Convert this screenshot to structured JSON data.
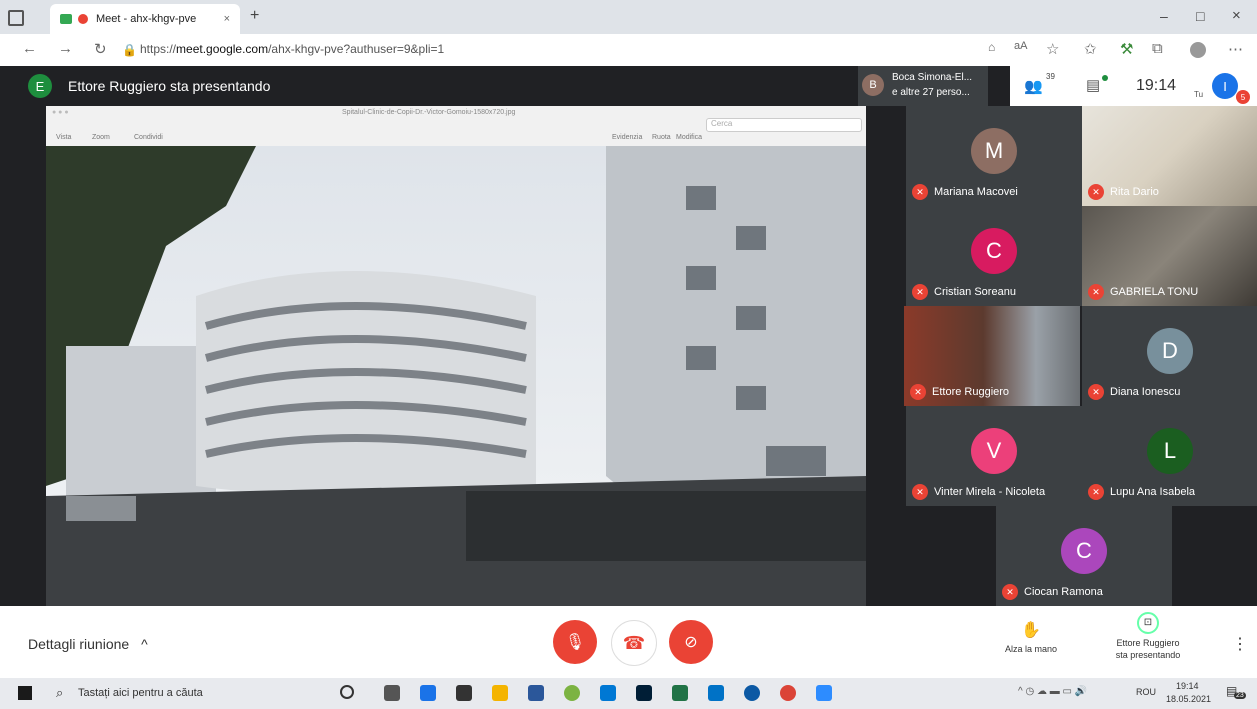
{
  "browser": {
    "tab_title": "Meet - ahx-khgv-pve",
    "new_tab_symbol": "+",
    "url_prefix": "https://",
    "url_domain": "meet.google.com",
    "url_path": "/ahx-khgv-pve?authuser=9&pli=1",
    "window_controls": [
      "–",
      "□",
      "×"
    ]
  },
  "meet": {
    "presenter_initial": "E",
    "presenter_banner": "Ettore Ruggiero sta presentando",
    "participants_preview_initial": "B",
    "participants_preview_line1": "Boca Simona-El...",
    "participants_preview_line2": "e altre 27 perso...",
    "participant_count": "39",
    "clock": "19:14",
    "self_label": "Tu",
    "self_initial": "I",
    "notification_count": "5"
  },
  "presentation": {
    "window_title": "Spitalul-Clinic-de-Copii-Dr.-Victor-Gomoiu-1580x720.jpg",
    "toolbar_items": [
      "Vista",
      "Zoom",
      "Condividi"
    ],
    "toolbar_right_items": [
      "Evidenzia",
      "Ruota",
      "Modifica"
    ],
    "search_placeholder": "Cerca"
  },
  "tiles": [
    {
      "initial": "M",
      "name": "Mariana Macovei",
      "color": "#8d6e63"
    },
    {
      "initial": "",
      "name": "Rita Dario",
      "color": ""
    },
    {
      "initial": "C",
      "name": "Cristian Soreanu",
      "color": "#d81b60"
    },
    {
      "initial": "",
      "name": "GABRIELA TONU",
      "color": ""
    },
    {
      "initial": "",
      "name": "Ettore Ruggiero",
      "color": ""
    },
    {
      "initial": "D",
      "name": "Diana Ionescu",
      "color": "#78909c"
    },
    {
      "initial": "V",
      "name": "Vinter Mirela - Nicoleta",
      "color": "#ec407a"
    },
    {
      "initial": "L",
      "name": "Lupu Ana Isabela",
      "color": "#1b5e20"
    },
    {
      "initial": "C",
      "name": "Ciocan Ramona",
      "color": "#ab47bc"
    }
  ],
  "controls": {
    "meeting_details": "Dettagli riunione",
    "chevron": "^",
    "raise_hand": "Alza la mano",
    "presenting_line1": "Ettore Ruggiero",
    "presenting_line2": "sta presentando",
    "more": "⋮"
  },
  "taskbar": {
    "search_placeholder": "Tastați aici pentru a căuta",
    "lang": "ROU",
    "time": "19:14",
    "date": "18.05.2021",
    "notif_count": "23"
  },
  "colors": {
    "meet_dark": "#202124",
    "tile_gray": "#3c4043",
    "mic_off_red": "#ea4335",
    "self_avatar": "#1a73e8"
  }
}
